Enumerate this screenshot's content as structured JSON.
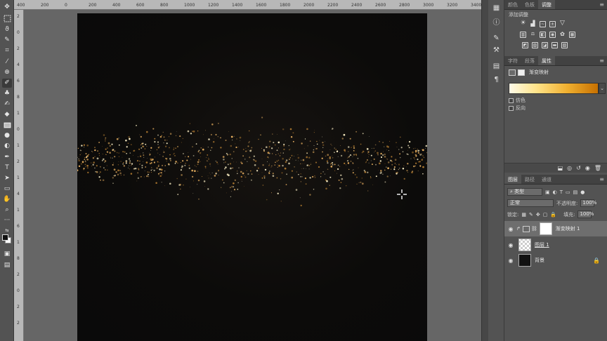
{
  "ruler_top": {
    "ticks": [
      "400",
      "200",
      "0",
      "200",
      "400",
      "600",
      "800",
      "1000",
      "1200",
      "1400",
      "1600",
      "1800",
      "2000",
      "2200",
      "2400",
      "2600",
      "2800",
      "3000",
      "3200",
      "3400"
    ]
  },
  "ruler_left": {
    "ticks": [
      "2",
      "0",
      "2",
      "4",
      "6",
      "8",
      "1",
      "0",
      "1",
      "2",
      "1",
      "4",
      "1",
      "6",
      "1",
      "8",
      "2",
      "0",
      "2",
      "2"
    ]
  },
  "tools": [
    "move-tool",
    "marquee-tool",
    "lasso-tool",
    "quick-select-tool",
    "crop-tool",
    "eyedropper-tool",
    "healing-tool",
    "brush-tool",
    "stamp-tool",
    "history-brush-tool",
    "eraser-tool",
    "gradient-tool",
    "blur-tool",
    "dodge-tool",
    "pen-tool",
    "text-tool",
    "path-select-tool",
    "shape-tool",
    "hand-tool",
    "zoom-tool",
    "more-tools"
  ],
  "top_tabs": {
    "tabs": [
      "颜色",
      "色板",
      "调整"
    ],
    "active": 2
  },
  "adjustments": {
    "title": "添加调整"
  },
  "mid_tabs": {
    "tabs": [
      "字符",
      "段落",
      "属性"
    ],
    "active": 2
  },
  "properties": {
    "layer_title": "渐变映射",
    "options": [
      "仿色",
      "反向"
    ]
  },
  "layers_tabs": {
    "tabs": [
      "图层",
      "路径",
      "通道"
    ],
    "active": 0
  },
  "layers": {
    "filter_label": "类型",
    "blend_mode": "正常",
    "opacity_label": "不透明度:",
    "opacity_value": "100%",
    "lock_label": "锁定:",
    "fill_label": "填充:",
    "fill_value": "100%",
    "items": [
      {
        "name": "渐变映射 1",
        "selected": true
      },
      {
        "name": "图层 1",
        "selected": false
      },
      {
        "name": "背景",
        "selected": false
      }
    ]
  },
  "colors": {
    "gradient_start": "#fffbe9",
    "gradient_end": "#c77000",
    "sparkle": "#e8b060",
    "canvas": "#0c0b0a"
  }
}
